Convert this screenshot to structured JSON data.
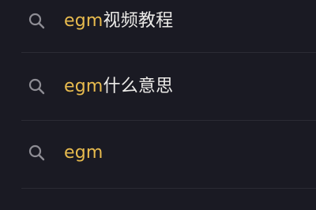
{
  "search_suggestions": {
    "icon": "search-icon",
    "highlight_color": "#e8bb4e",
    "text_color": "#ecebe8",
    "background_color": "#1a1a23",
    "items": [
      {
        "highlight": "egm",
        "rest": "视频教程"
      },
      {
        "highlight": "egm",
        "rest": "什么意思"
      },
      {
        "highlight": "egm",
        "rest": ""
      }
    ]
  }
}
